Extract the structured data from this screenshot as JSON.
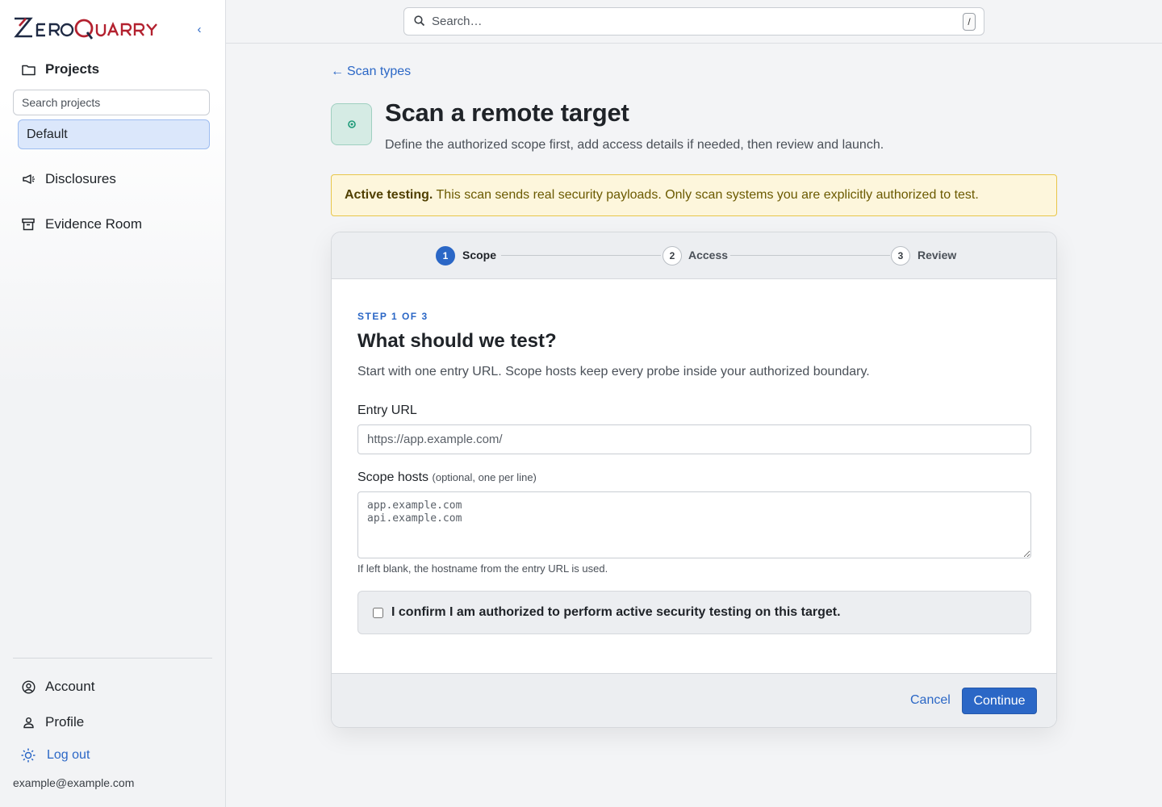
{
  "brand": {
    "logo_text": "ZeroQuarry",
    "accent": "#b3212f",
    "primary": "#2b67c6"
  },
  "sidebar": {
    "collapse_icon": "chevron-left-icon",
    "projects_label": "Projects",
    "search_placeholder": "Search projects",
    "projects": [
      {
        "label": "Default",
        "selected": true
      }
    ],
    "items": [
      {
        "label": "Disclosures",
        "icon": "megaphone-icon"
      },
      {
        "label": "Evidence Room",
        "icon": "archive-icon"
      }
    ],
    "bottom": {
      "account_label": "Account",
      "profile_label": "Profile",
      "logout_label": "Log out",
      "email": "example@example.com"
    }
  },
  "topbar": {
    "search_placeholder": "Search…",
    "shortcut": "/"
  },
  "page": {
    "back_label": "Scan types",
    "title": "Scan a remote target",
    "subtitle": "Define the authorized scope first, add access details if needed, then review and launch.",
    "alert_strong": "Active testing.",
    "alert_text": " This scan sends real security payloads. Only scan systems you are explicitly authorized to test."
  },
  "wizard": {
    "steps": [
      {
        "number": "1",
        "label": "Scope",
        "active": true
      },
      {
        "number": "2",
        "label": "Access",
        "active": false
      },
      {
        "number": "3",
        "label": "Review",
        "active": false
      }
    ],
    "kicker": "STEP 1 OF 3",
    "title": "What should we test?",
    "description": "Start with one entry URL. Scope hosts keep every probe inside your authorized boundary.",
    "entry_url_label": "Entry URL",
    "entry_url_placeholder": "https://app.example.com/",
    "scope_label": "Scope hosts",
    "scope_hint": "(optional, one per line)",
    "scope_placeholder": "app.example.com\napi.example.com",
    "scope_help": "If left blank, the hostname from the entry URL is used.",
    "confirm_label": "I confirm I am authorized to perform active security testing on this target.",
    "cancel_label": "Cancel",
    "continue_label": "Continue"
  }
}
